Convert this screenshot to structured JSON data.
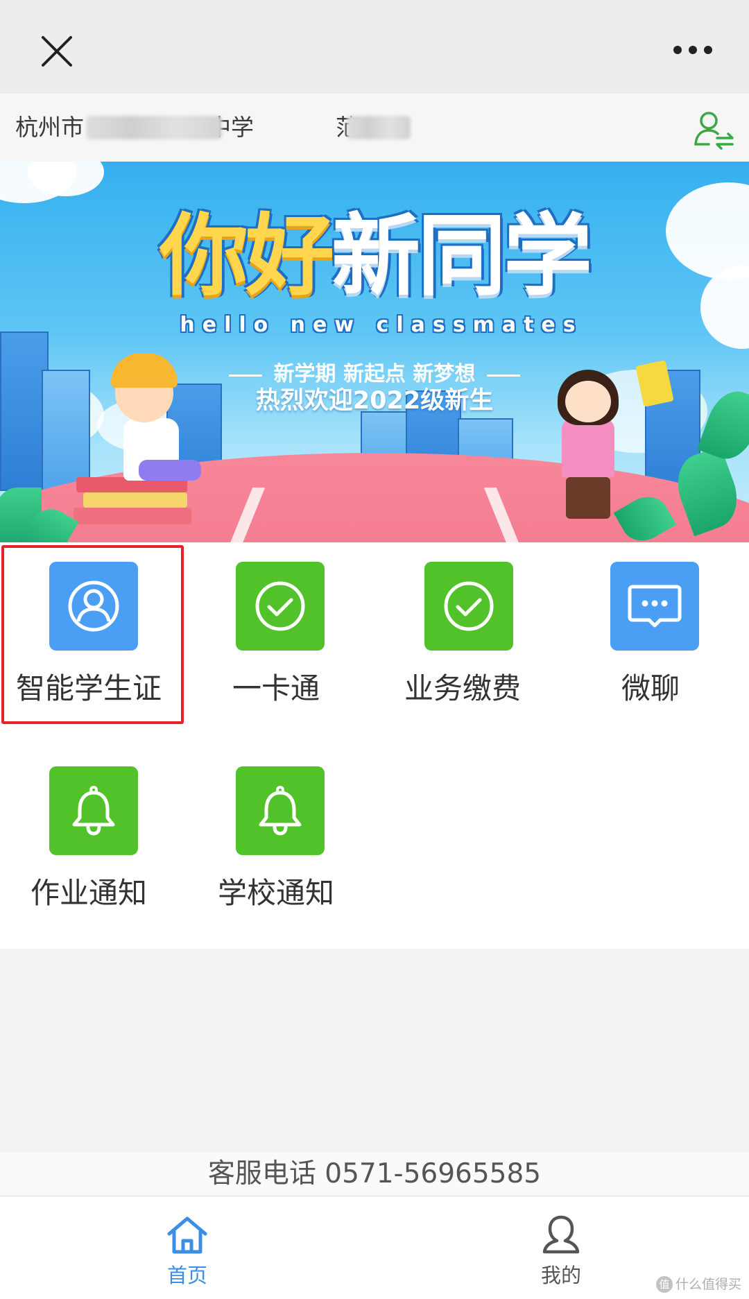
{
  "top_bar": {
    "close_icon": "close-icon",
    "more_icon": "more-icon"
  },
  "header": {
    "school_prefix": "杭州市",
    "school_suffix": "中学",
    "name_prefix": "范",
    "switch_icon": "user-switch-icon"
  },
  "banner": {
    "title_part1": "你好",
    "title_part2": "新同学",
    "subtitle_en": "hello new classmates",
    "slogan": "新学期 新起点 新梦想",
    "welcome": "热烈欢迎2022级新生"
  },
  "grid": {
    "items": [
      {
        "label": "智能学生证",
        "icon": "student-card-icon",
        "color": "#4a9ff5",
        "highlighted": true
      },
      {
        "label": "一卡通",
        "icon": "check-circle-icon",
        "color": "#52c22b"
      },
      {
        "label": "业务缴费",
        "icon": "check-circle-icon",
        "color": "#52c22b"
      },
      {
        "label": "微聊",
        "icon": "chat-icon",
        "color": "#4a9ff5"
      },
      {
        "label": "作业通知",
        "icon": "bell-icon",
        "color": "#52c22b"
      },
      {
        "label": "学校通知",
        "icon": "bell-icon",
        "color": "#52c22b"
      }
    ]
  },
  "service": {
    "text": "客服电话 0571-56965585"
  },
  "tabbar": {
    "items": [
      {
        "label": "首页",
        "icon": "home-icon",
        "active": true,
        "color": "#3a8ee6"
      },
      {
        "label": "我的",
        "icon": "user-icon",
        "active": false,
        "color": "#555555"
      }
    ]
  },
  "watermark": {
    "badge": "值",
    "text": "什么值得买"
  },
  "colors": {
    "highlight_border": "#e6222b",
    "accent_green": "#52c22b",
    "accent_blue": "#4a9ff5"
  }
}
